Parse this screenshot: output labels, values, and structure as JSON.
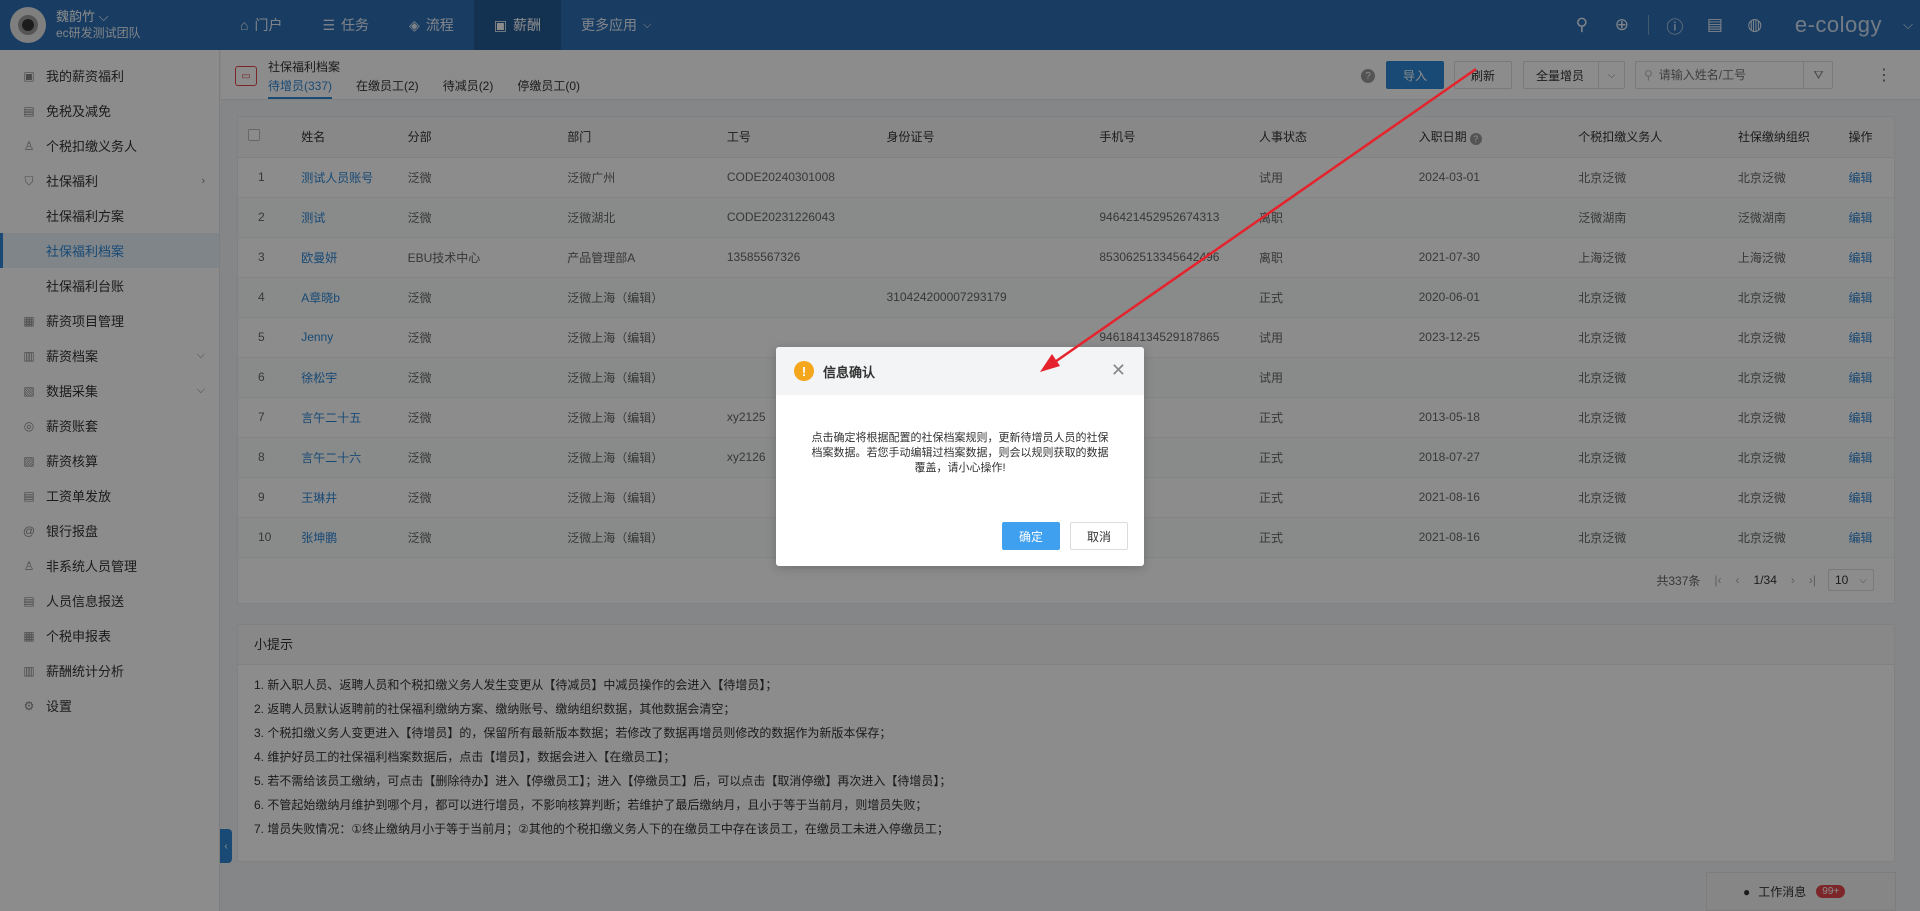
{
  "header": {
    "user_name": "魏韵竹",
    "team": "ec研发测试团队",
    "nav": [
      {
        "icon": "home-icon",
        "glyph": "⌂",
        "label": "门户"
      },
      {
        "icon": "list-icon",
        "glyph": "☰",
        "label": "任务"
      },
      {
        "icon": "layers-icon",
        "glyph": "◈",
        "label": "流程"
      },
      {
        "icon": "money-icon",
        "glyph": "▣",
        "label": "薪酬"
      },
      {
        "icon": "",
        "glyph": "",
        "label": "更多应用"
      }
    ],
    "logo": "e-cology"
  },
  "sidebar": {
    "items": [
      {
        "label": "我的薪资福利"
      },
      {
        "label": "免税及减免"
      },
      {
        "label": "个税扣缴义务人"
      },
      {
        "label": "社保福利"
      },
      {
        "label": "社保福利方案"
      },
      {
        "label": "社保福利档案"
      },
      {
        "label": "社保福利台账"
      },
      {
        "label": "薪资项目管理"
      },
      {
        "label": "薪资档案"
      },
      {
        "label": "数据采集"
      },
      {
        "label": "薪资账套"
      },
      {
        "label": "薪资核算"
      },
      {
        "label": "工资单发放"
      },
      {
        "label": "银行报盘"
      },
      {
        "label": "非系统人员管理"
      },
      {
        "label": "人员信息报送"
      },
      {
        "label": "个税申报表"
      },
      {
        "label": "薪酬统计分析"
      },
      {
        "label": "设置"
      }
    ]
  },
  "content": {
    "title": "社保福利档案",
    "tabs": [
      "待增员(337)",
      "在缴员工(2)",
      "待减员(2)",
      "停缴员工(0)"
    ],
    "import_label": "导入",
    "refresh_label": "刷新",
    "scope_label": "全量增员",
    "search_placeholder": "请输入姓名/工号"
  },
  "table": {
    "columns": [
      "姓名",
      "分部",
      "部门",
      "工号",
      "身份证号",
      "手机号",
      "人事状态",
      "入职日期",
      "个税扣缴义务人",
      "社保缴纳组织",
      "操作"
    ],
    "rows": [
      [
        "1",
        "测试人员账号",
        "泛微",
        "泛微广州",
        "CODE20240301008",
        "",
        "",
        "试用",
        "2024-03-01",
        "北京泛微",
        "北京泛微",
        "编辑"
      ],
      [
        "2",
        "测试",
        "泛微",
        "泛微湖北",
        "CODE20231226043",
        "",
        "946421452952674313",
        "离职",
        "",
        "泛微湖南",
        "泛微湖南",
        "编辑"
      ],
      [
        "3",
        "欧曼妍",
        "EBU技术中心",
        "产品管理部A",
        "13585567326",
        "",
        "853062513345642496",
        "离职",
        "2021-07-30",
        "上海泛微",
        "上海泛微",
        "编辑"
      ],
      [
        "4",
        "A章晓b",
        "泛微",
        "泛微上海（编辑）",
        "",
        "310424200007293179",
        "",
        "正式",
        "2020-06-01",
        "北京泛微",
        "北京泛微",
        "编辑"
      ],
      [
        "5",
        "Jenny",
        "泛微",
        "泛微上海（编辑）",
        "",
        "",
        "946184134529187865",
        "试用",
        "2023-12-25",
        "北京泛微",
        "北京泛微",
        "编辑"
      ],
      [
        "6",
        "徐松宇",
        "泛微",
        "泛微上海（编辑）",
        "",
        "",
        "",
        "试用",
        "",
        "北京泛微",
        "北京泛微",
        "编辑"
      ],
      [
        "7",
        "言午二十五",
        "泛微",
        "泛微上海（编辑）",
        "xy2125",
        "",
        "",
        "正式",
        "2013-05-18",
        "北京泛微",
        "北京泛微",
        "编辑"
      ],
      [
        "8",
        "言午二十六",
        "泛微",
        "泛微上海（编辑）",
        "xy2126",
        "",
        "",
        "正式",
        "2018-07-27",
        "北京泛微",
        "北京泛微",
        "编辑"
      ],
      [
        "9",
        "王琳井",
        "泛微",
        "泛微上海（编辑）",
        "",
        "",
        "",
        "正式",
        "2021-08-16",
        "北京泛微",
        "北京泛微",
        "编辑"
      ],
      [
        "10",
        "张坤鹏",
        "泛微",
        "泛微上海（编辑）",
        "",
        "",
        "",
        "正式",
        "2021-08-16",
        "北京泛微",
        "北京泛微",
        "编辑"
      ]
    ],
    "pager": {
      "total": "共337条",
      "page": "1/34",
      "size": "10"
    }
  },
  "tips": {
    "title": "小提示",
    "items": [
      "1. 新入职人员、返聘人员和个税扣缴义务人发生变更从【待减员】中减员操作的会进入【待增员】；",
      "2. 返聘人员默认返聘前的社保福利缴纳方案、缴纳账号、缴纳组织数据，其他数据会清空；",
      "3. 个税扣缴义务人变更进入【待增员】的，保留所有最新版本数据；若修改了数据再增员则修改的数据作为新版本保存；",
      "4. 维护好员工的社保福利档案数据后，点击【增员】，数据会进入【在缴员工】；",
      "5. 若不需给该员工缴纳，可点击【删除待办】进入【停缴员工】；进入【停缴员工】后，可以点击【取消停缴】再次进入【待增员】；",
      "6. 不管起始缴纳月维护到哪个月，都可以进行增员，不影响核算判断；若维护了最后缴纳月，且小于等于当前月，则增员失败；",
      "7. 增员失败情况：①终止缴纳月小于等于当前月；②其他的个税扣缴义务人下的在缴员工中存在该员工，在缴员工未进入停缴员工；"
    ]
  },
  "chat": {
    "label": "工作消息",
    "badge": "99+"
  },
  "modal": {
    "title": "信息确认",
    "body": "点击确定将根据配置的社保档案规则，更新待增员人员的社保档案数据。若您手动编辑过档案数据，则会以规则获取的数据覆盖，请小心操作!",
    "ok_label": "确定",
    "cancel_label": "取消"
  },
  "colors": {
    "primary": "#2e6fb3",
    "accent": "#2e88d6",
    "warning": "#f4a61d",
    "annotation": "#e5232c"
  }
}
